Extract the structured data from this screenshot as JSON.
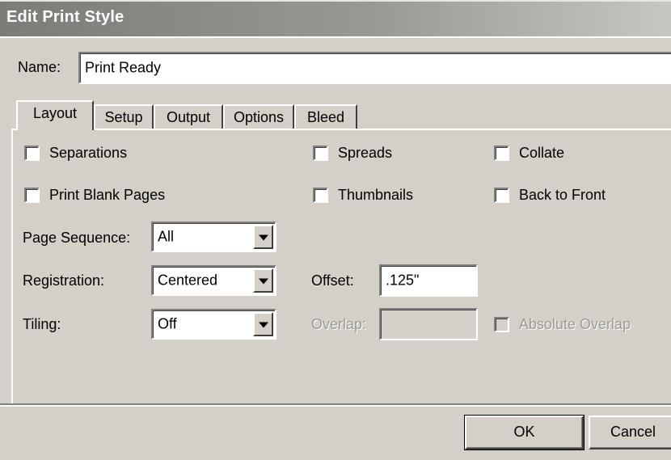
{
  "window": {
    "title": "Edit Print Style"
  },
  "name_field": {
    "label": "Name:",
    "value": "Print Ready"
  },
  "tabs": [
    {
      "label": "Layout",
      "active": true
    },
    {
      "label": "Setup",
      "active": false
    },
    {
      "label": "Output",
      "active": false
    },
    {
      "label": "Options",
      "active": false
    },
    {
      "label": "Bleed",
      "active": false
    }
  ],
  "checkboxes": {
    "separations": {
      "label": "Separations",
      "checked": false,
      "enabled": true
    },
    "spreads": {
      "label": "Spreads",
      "checked": false,
      "enabled": true
    },
    "collate": {
      "label": "Collate",
      "checked": false,
      "enabled": true
    },
    "print_blank_pages": {
      "label": "Print Blank Pages",
      "checked": false,
      "enabled": true
    },
    "thumbnails": {
      "label": "Thumbnails",
      "checked": false,
      "enabled": true
    },
    "back_to_front": {
      "label": "Back to Front",
      "checked": false,
      "enabled": true
    },
    "absolute_overlap": {
      "label": "Absolute Overlap",
      "checked": false,
      "enabled": false
    }
  },
  "page_sequence": {
    "label": "Page Sequence:",
    "value": "All"
  },
  "registration": {
    "label": "Registration:",
    "value": "Centered"
  },
  "offset": {
    "label": "Offset:",
    "value": ".125\""
  },
  "tiling": {
    "label": "Tiling:",
    "value": "Off"
  },
  "overlap": {
    "label": "Overlap:",
    "value": "",
    "enabled": false
  },
  "buttons": {
    "ok": "OK",
    "cancel": "Cancel"
  },
  "colors": {
    "face": "#d4d0c8",
    "shadow": "#808080",
    "highlight": "#ffffff",
    "disabled_text": "#9c9a96"
  }
}
